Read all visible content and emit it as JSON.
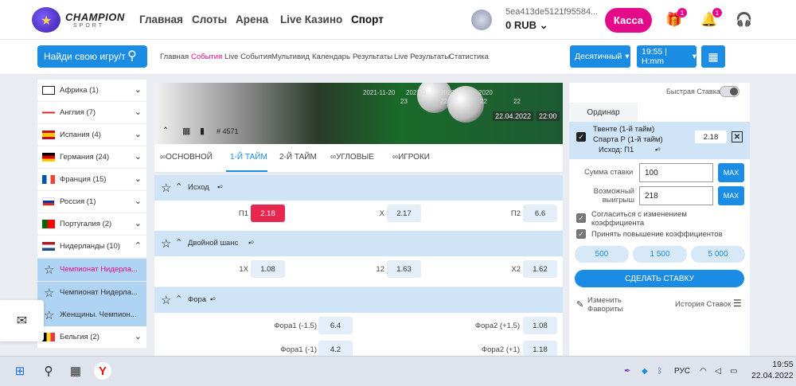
{
  "header": {
    "brand": "CHAMPION",
    "brand_sub": "SPORT",
    "nav": [
      "Главная",
      "Слоты",
      "Арена",
      "Live Казино",
      "Спорт"
    ],
    "account_id": "5ea413de5121f95584...",
    "balance": "0 RUB",
    "cashier": "Касса",
    "gift_count": "1",
    "notif_count": "1"
  },
  "subbar": {
    "search_label": "Найди свою игру/т",
    "links": [
      "Главная",
      "События",
      "Live События",
      "Мультивид",
      "Календарь",
      "Результаты",
      "Live Результаты",
      "Статистика"
    ],
    "odds_format": "Десятичный",
    "time_format": "19:55 | H:mm"
  },
  "sidebar": {
    "countries": [
      {
        "label": "Африка (1)"
      },
      {
        "label": "Англия (7)"
      },
      {
        "label": "Испания (4)"
      },
      {
        "label": "Германия (24)"
      },
      {
        "label": "Франция (15)"
      },
      {
        "label": "Россия (1)"
      },
      {
        "label": "Португалия (2)"
      },
      {
        "label": "Нидерланды (10)"
      }
    ],
    "leagues": [
      {
        "label": "Чемпионат Нидерла..."
      },
      {
        "label": "Чемпионат Нидерла..."
      },
      {
        "label": "Женщины. Чемпион..."
      }
    ],
    "after": {
      "label": "Бельгия (2)"
    }
  },
  "banner": {
    "dates": [
      "2021-11-20",
      "2021-0",
      "2020",
      "2020",
      "22",
      "22",
      "22",
      "23"
    ],
    "date": "22.04.2022",
    "time": "22:00",
    "code": "# 4571"
  },
  "tabs": [
    "ОСНОВНОЙ",
    "1-Й ТАЙМ",
    "2-Й ТАЙМ",
    "УГЛОВЫЕ",
    "ИГРОКИ"
  ],
  "markets": [
    {
      "title": "Исход",
      "rows": [
        [
          {
            "l": "П1",
            "v": "2.18"
          },
          {
            "l": "X",
            "v": "2.17"
          },
          {
            "l": "П2",
            "v": "6.6"
          }
        ]
      ]
    },
    {
      "title": "Двойной шанс",
      "rows": [
        [
          {
            "l": "1X",
            "v": "1.08"
          },
          {
            "l": "12",
            "v": "1.63"
          },
          {
            "l": "X2",
            "v": "1.62"
          }
        ]
      ]
    },
    {
      "title": "Фора",
      "rows": [
        [
          {
            "l": "Фора1 (-1.5)",
            "v": "6.4"
          },
          {
            "l": "Фора2 (+1.5)",
            "v": "1.08"
          }
        ],
        [
          {
            "l": "Фора1 (-1)",
            "v": "4.2"
          },
          {
            "l": "Фора2 (+1)",
            "v": "1.18"
          }
        ]
      ]
    }
  ],
  "slip": {
    "quick_bet": "Быстрая Ставка",
    "tab": "Ординар",
    "team1": "Твенте (1-й тайм)",
    "team2": "Спарта Р (1-й тайм)",
    "outcome": "Исход: П1",
    "odd": "2.18",
    "stake_label": "Сумма ставки",
    "stake": "100",
    "win_label1": "Возможный",
    "win_label2": "выигрыш",
    "win": "218",
    "max": "MAX",
    "agree1": "Согласиться с изменением",
    "agree1b": "коэффициента",
    "agree2": "Принять повышение коэффициентов",
    "quick": [
      "500",
      "1 500",
      "5 000"
    ],
    "make_bet": "СДЕЛАТЬ СТАВКУ",
    "fav1": "Изменить",
    "fav2": "Фавориты",
    "history": "История Ставок"
  },
  "taskbar": {
    "lang": "РУС",
    "time": "19:55",
    "date": "22.04.2022"
  }
}
